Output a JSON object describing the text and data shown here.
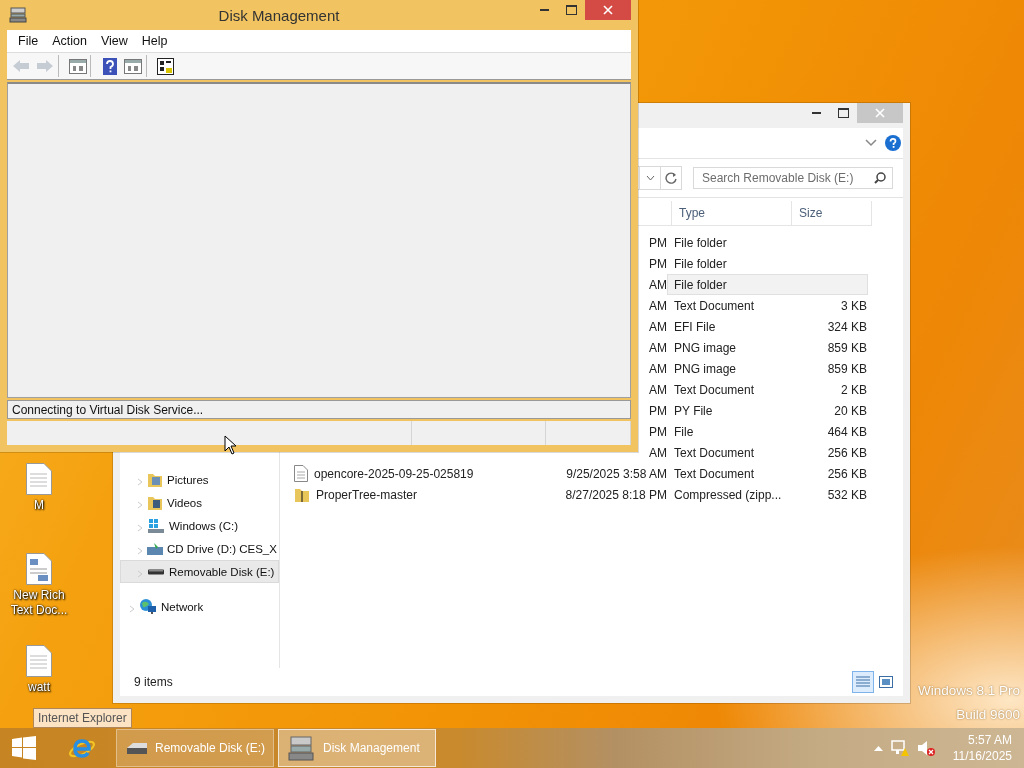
{
  "disk_management": {
    "title": "Disk Management",
    "menu": [
      "File",
      "Action",
      "View",
      "Help"
    ],
    "toolbar": [
      {
        "kind": "back",
        "disabled": true,
        "separator_before": false
      },
      {
        "kind": "forward",
        "disabled": true,
        "separator_before": false
      },
      {
        "kind": "panel",
        "disabled": false,
        "separator_before": true
      },
      {
        "kind": "help",
        "disabled": false,
        "separator_before": true
      },
      {
        "kind": "panel",
        "disabled": false,
        "separator_before": false
      },
      {
        "kind": "properties",
        "disabled": false,
        "separator_before": true
      }
    ],
    "status_text": "Connecting to Virtual Disk Service..."
  },
  "explorer": {
    "search": {
      "placeholder": "Search Removable Disk (E:)"
    },
    "columns": [
      "Type",
      "Size"
    ],
    "nav_items": [
      {
        "label": "Pictures",
        "kind": "pictures",
        "selected": false
      },
      {
        "label": "Videos",
        "kind": "videos",
        "selected": false
      },
      {
        "label": "Windows (C:)",
        "kind": "system-drive",
        "selected": false
      },
      {
        "label": "CD Drive (D:) CES_X",
        "kind": "cd-drive",
        "selected": false
      },
      {
        "label": "Removable Disk (E:)",
        "kind": "removable-drive",
        "selected": true
      },
      {
        "label": "Network",
        "kind": "network",
        "selected": false
      }
    ],
    "files": [
      {
        "date": "PM",
        "type": "File folder",
        "hovered": false
      },
      {
        "date": "PM",
        "type": "File folder",
        "hovered": false
      },
      {
        "date": "AM",
        "type": "File folder",
        "hovered": true
      },
      {
        "date": "AM",
        "type": "Text Document",
        "size": "3 KB",
        "hovered": false
      },
      {
        "date": "AM",
        "type": "EFI File",
        "size": "324 KB",
        "hovered": false
      },
      {
        "date": "AM",
        "type": "PNG image",
        "size": "859 KB",
        "hovered": false
      },
      {
        "date": "AM",
        "type": "PNG image",
        "size": "859 KB",
        "hovered": false
      },
      {
        "date": "AM",
        "type": "Text Document",
        "size": "2 KB",
        "hovered": false
      },
      {
        "date": "PM",
        "type": "PY File",
        "size": "20 KB",
        "hovered": false
      },
      {
        "date": "PM",
        "type": "File",
        "size": "464 KB",
        "hovered": false
      },
      {
        "date": "AM",
        "type": "Text Document",
        "size": "256 KB",
        "hovered": false
      },
      {
        "name": "opencore-2025-09-25-025819",
        "kind": "text-document",
        "date": "9/25/2025 3:58 AM",
        "type": "Text Document",
        "size": "256 KB",
        "hovered": false
      },
      {
        "name": "ProperTree-master",
        "kind": "zip-folder",
        "date": "8/27/2025 8:18 PM",
        "type": "Compressed (zipp...",
        "size": "532 KB",
        "hovered": false
      }
    ],
    "status": "9 items",
    "views": [
      {
        "kind": "details",
        "selected": true
      },
      {
        "kind": "large-icons",
        "selected": false
      }
    ]
  },
  "desktop_icons": [
    {
      "label": "M",
      "kind": "text"
    },
    {
      "label": "New Rich Text Doc...",
      "kind": "rich-text"
    },
    {
      "label": "watt",
      "kind": "text"
    }
  ],
  "tooltip": "Internet Explorer",
  "watermark": [
    "Windows 8.1 Pro",
    "Build 9600"
  ],
  "taskbar": {
    "tasks": [
      {
        "label": "Removable Disk (E:)",
        "kind": "drive",
        "selected": false
      },
      {
        "label": "Disk Management",
        "kind": "disk-management",
        "selected": true
      }
    ],
    "time": "5:57 AM",
    "date": "11/16/2025"
  }
}
